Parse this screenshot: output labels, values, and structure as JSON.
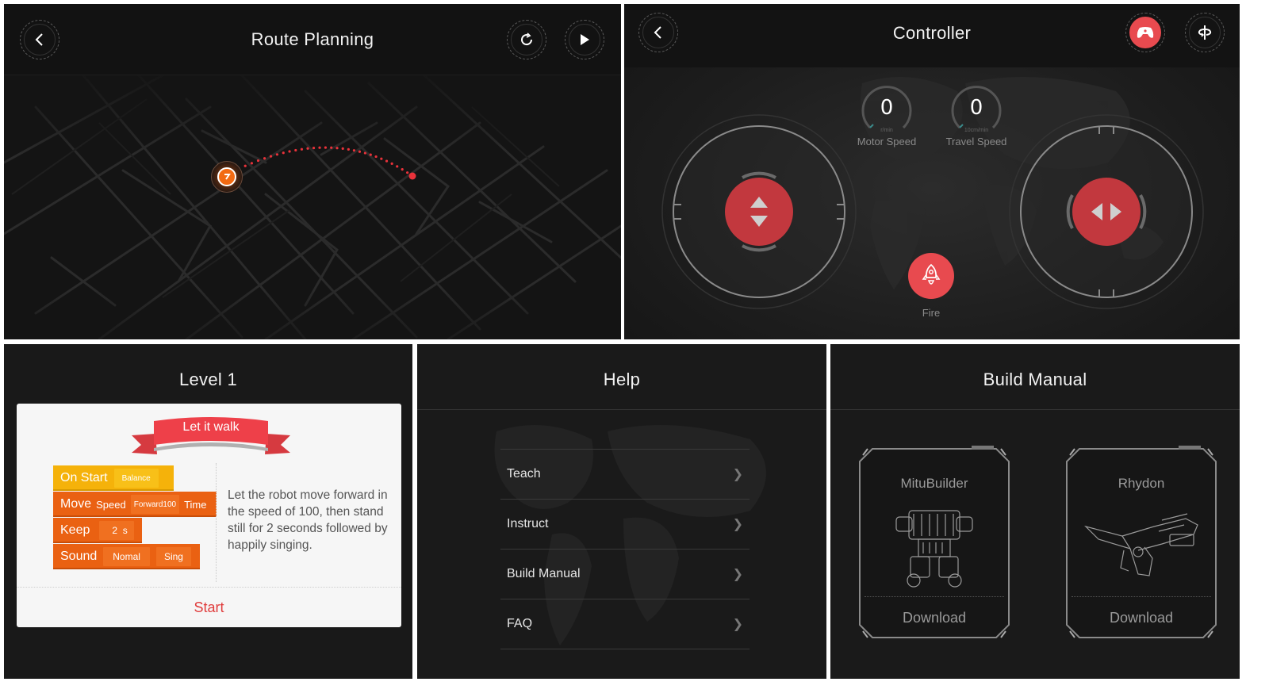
{
  "route_planning": {
    "title": "Route Planning",
    "back_icon": "chevron-left-icon",
    "refresh_icon": "refresh-icon",
    "play_icon": "play-icon",
    "start_marker_icon": "location-marker-icon",
    "route_color": "#e8323a",
    "marker_color": "#f26a12"
  },
  "controller": {
    "title": "Controller",
    "back_icon": "chevron-left-icon",
    "gamepad_icon": "gamepad-icon",
    "rotate_icon": "rotate-axis-icon",
    "accent_color": "#e84a4f",
    "gauges": [
      {
        "value": "0",
        "unit": "r/min",
        "label": "Motor Speed"
      },
      {
        "value": "0",
        "unit": "10cm/min",
        "label": "Travel Speed"
      }
    ],
    "left_joystick_icon": "up-down-arrows-icon",
    "right_joystick_icon": "left-right-arrows-icon",
    "fire_label": "Fire",
    "fire_icon": "rocket-icon"
  },
  "level": {
    "title": "Level 1",
    "ribbon": "Let it walk",
    "blocks": {
      "on_start": {
        "label": "On Start",
        "slot": "Balance"
      },
      "move": {
        "label": "Move",
        "speed_label": "Speed",
        "slot": "Forward100",
        "time_label": "Time"
      },
      "keep": {
        "label": "Keep",
        "value": "2",
        "unit": "s"
      },
      "sound": {
        "label": "Sound",
        "slot1": "Nomal",
        "slot2": "Sing"
      }
    },
    "description": "Let the robot move forward in the speed of 100, then stand still for 2 seconds followed by happily singing.",
    "start_label": "Start"
  },
  "help": {
    "title": "Help",
    "items": [
      {
        "label": "Teach"
      },
      {
        "label": "Instruct"
      },
      {
        "label": "Build Manual"
      },
      {
        "label": "FAQ"
      }
    ]
  },
  "build_manual": {
    "title": "Build Manual",
    "robots": [
      {
        "name": "MituBuilder",
        "action": "Download"
      },
      {
        "name": "Rhydon",
        "action": "Download"
      }
    ]
  }
}
